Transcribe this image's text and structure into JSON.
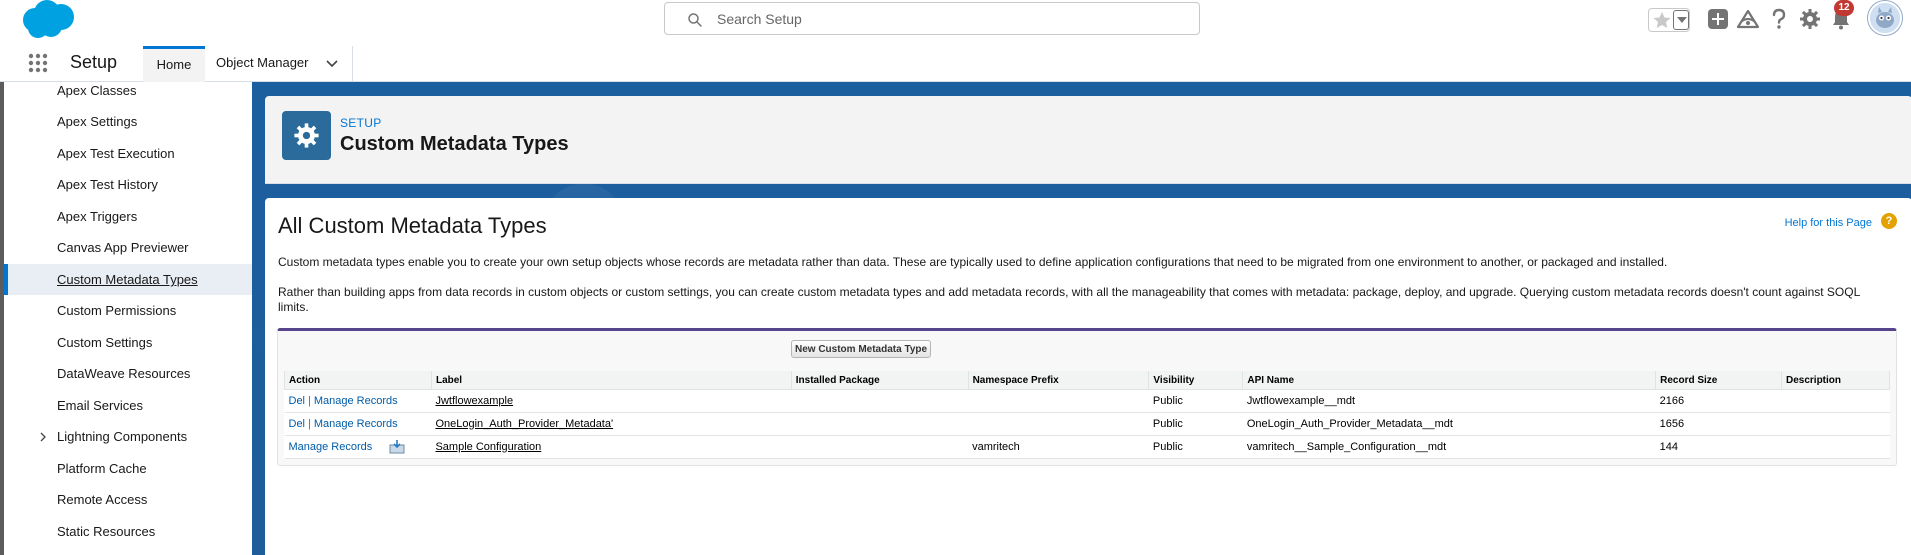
{
  "header": {
    "search_placeholder": "Search Setup",
    "notification_count": "12",
    "icons": [
      "salesforce-logo-icon",
      "search-icon",
      "star-icon",
      "chevron-down-icon",
      "plus-icon",
      "trailhead-icon",
      "help-icon",
      "gear-icon",
      "bell-icon",
      "avatar-icon"
    ]
  },
  "nav": {
    "app_name": "Setup",
    "tabs": [
      {
        "label": "Home"
      },
      {
        "label": "Object Manager"
      }
    ]
  },
  "sidebar": {
    "items": [
      {
        "label": "Apex Classes"
      },
      {
        "label": "Apex Settings"
      },
      {
        "label": "Apex Test Execution"
      },
      {
        "label": "Apex Test History"
      },
      {
        "label": "Apex Triggers"
      },
      {
        "label": "Canvas App Previewer"
      },
      {
        "label": "Custom Metadata Types"
      },
      {
        "label": "Custom Permissions"
      },
      {
        "label": "Custom Settings"
      },
      {
        "label": "DataWeave Resources"
      },
      {
        "label": "Email Services"
      },
      {
        "label": "Lightning Components"
      },
      {
        "label": "Platform Cache"
      },
      {
        "label": "Remote Access"
      },
      {
        "label": "Static Resources"
      }
    ]
  },
  "page_header": {
    "breadcrumb": "SETUP",
    "title": "Custom Metadata Types"
  },
  "content": {
    "heading": "All Custom Metadata Types",
    "help_link": "Help for this Page",
    "description_1": "Custom metadata types enable you to create your own setup objects whose records are metadata rather than data. These are typically used to define application configurations that need to be migrated from one environment to another, or packaged and installed.",
    "description_2": "Rather than building apps from data records in custom objects or custom settings, you can create custom metadata types and add metadata records, with all the manageability that comes with metadata: package, deploy, and upgrade. Querying custom metadata records doesn't count against SOQL limits.",
    "new_button": "New Custom Metadata Type",
    "columns": [
      "Action",
      "Label",
      "Installed Package",
      "Namespace Prefix",
      "Visibility",
      "API Name",
      "Record Size",
      "Description"
    ],
    "rows": [
      {
        "del": "Del",
        "sep": "|",
        "manage": "Manage Records",
        "label": "Jwtflowexample",
        "installed_package": "",
        "namespace": "",
        "visibility": "Public",
        "api_name": "Jwtflowexample__mdt",
        "record_size": "2166",
        "description": ""
      },
      {
        "del": "Del",
        "sep": "|",
        "manage": "Manage Records",
        "label": "OneLogin_Auth_Provider_Metadata'",
        "installed_package": "",
        "namespace": "",
        "visibility": "Public",
        "api_name": "OneLogin_Auth_Provider_Metadata__mdt",
        "record_size": "1656",
        "description": ""
      },
      {
        "del": "",
        "sep": "",
        "manage": "Manage Records",
        "label": "Sample Configuration",
        "installed_package": "",
        "namespace": "vamritech",
        "visibility": "Public",
        "api_name": "vamritech__Sample_Configuration__mdt",
        "record_size": "144",
        "description": ""
      }
    ]
  }
}
